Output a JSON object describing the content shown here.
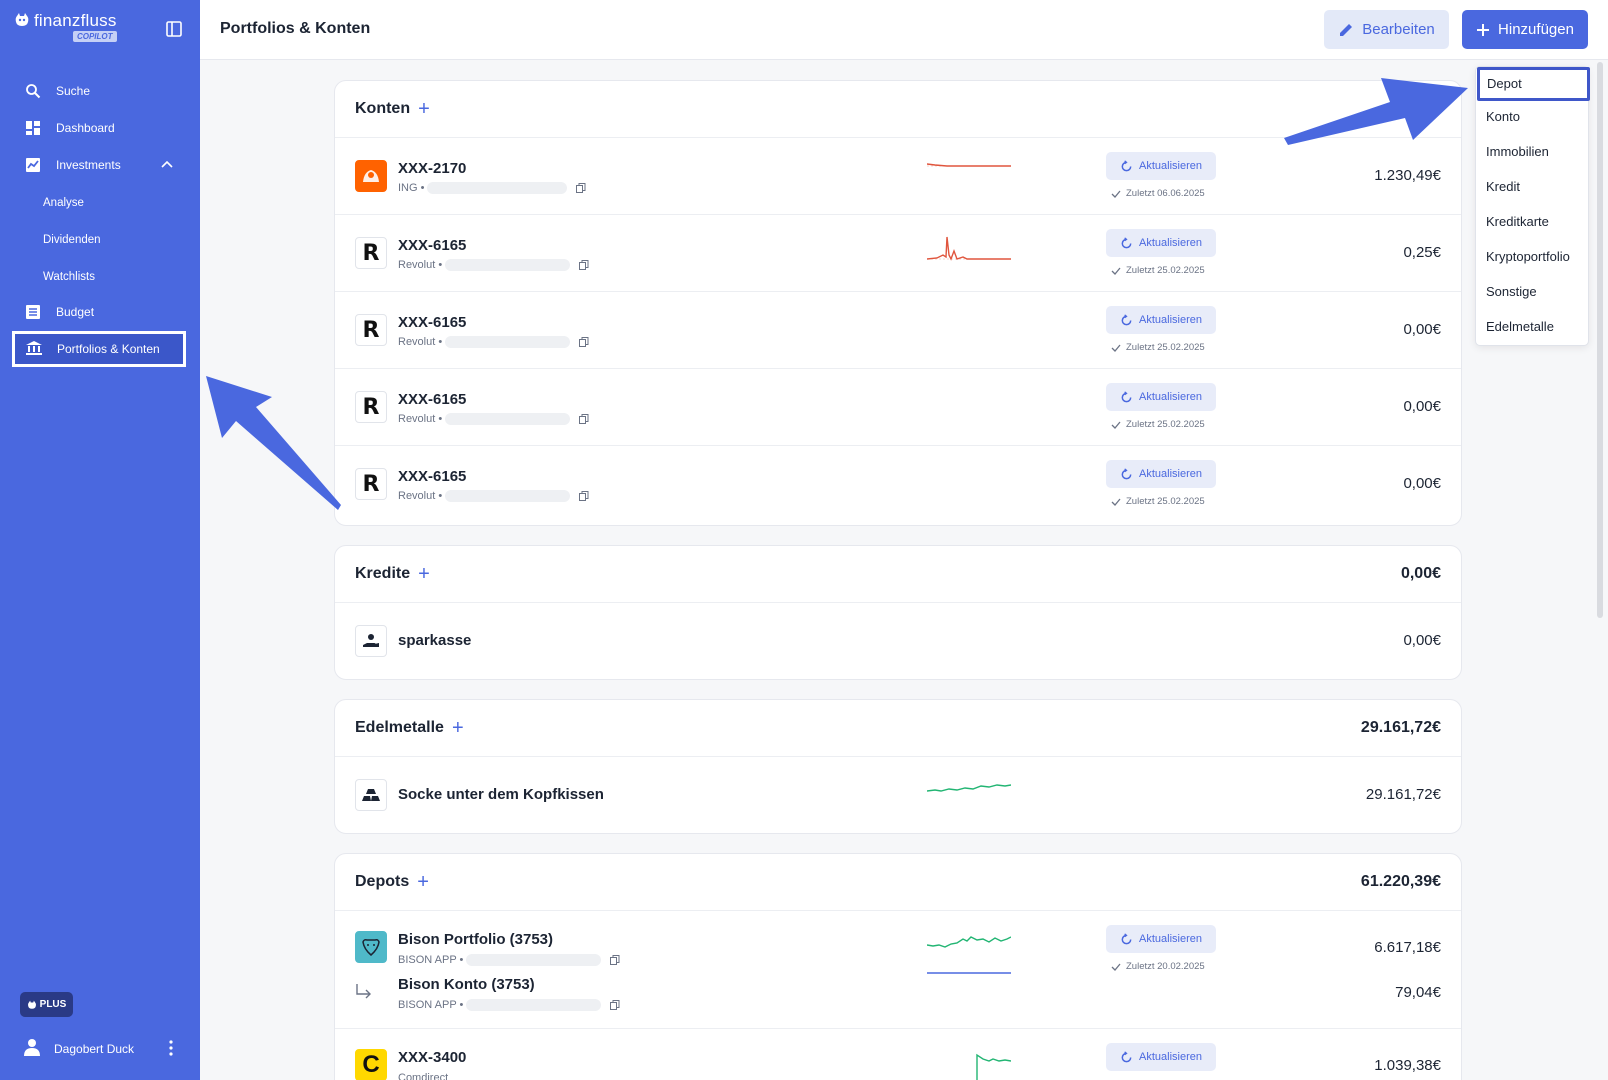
{
  "brand": {
    "name": "finanzfluss",
    "badge": "COPILOT"
  },
  "sidebar": {
    "items": [
      {
        "label": "Suche",
        "icon": "search-icon"
      },
      {
        "label": "Dashboard",
        "icon": "dashboard-icon"
      },
      {
        "label": "Investments",
        "icon": "chart-line-icon"
      },
      {
        "label": "Analyse"
      },
      {
        "label": "Dividenden"
      },
      {
        "label": "Watchlists"
      },
      {
        "label": "Budget",
        "icon": "list-icon"
      },
      {
        "label": "Portfolios & Konten",
        "icon": "bank-icon"
      }
    ],
    "plus_badge": "PLUS",
    "user_name": "Dagobert Duck"
  },
  "header": {
    "title": "Portfolios & Konten",
    "edit_label": "Bearbeiten",
    "add_label": "Hinzufügen"
  },
  "dropdown": {
    "items": [
      "Depot",
      "Konto",
      "Immobilien",
      "Kredit",
      "Kreditkarte",
      "Kryptoportfolio",
      "Sonstige",
      "Edelmetalle"
    ]
  },
  "sections": {
    "konten": {
      "title": "Konten",
      "rows": [
        {
          "name": "XXX-2170",
          "provider": "ING •",
          "refresh": "Aktualisieren",
          "updated": "Zuletzt 06.06.2025",
          "amount": "1.230,49€"
        },
        {
          "name": "XXX-6165",
          "provider": "Revolut •",
          "refresh": "Aktualisieren",
          "updated": "Zuletzt 25.02.2025",
          "amount": "0,25€"
        },
        {
          "name": "XXX-6165",
          "provider": "Revolut •",
          "refresh": "Aktualisieren",
          "updated": "Zuletzt 25.02.2025",
          "amount": "0,00€"
        },
        {
          "name": "XXX-6165",
          "provider": "Revolut •",
          "refresh": "Aktualisieren",
          "updated": "Zuletzt 25.02.2025",
          "amount": "0,00€"
        },
        {
          "name": "XXX-6165",
          "provider": "Revolut •",
          "refresh": "Aktualisieren",
          "updated": "Zuletzt 25.02.2025",
          "amount": "0,00€"
        }
      ]
    },
    "kredite": {
      "title": "Kredite",
      "total": "0,00€",
      "rows": [
        {
          "name": "sparkasse",
          "amount": "0,00€"
        }
      ]
    },
    "edelmetalle": {
      "title": "Edelmetalle",
      "total": "29.161,72€",
      "rows": [
        {
          "name": "Socke unter dem Kopfkissen",
          "amount": "29.161,72€"
        }
      ]
    },
    "depots": {
      "title": "Depots",
      "total": "61.220,39€",
      "rows": [
        {
          "name": "Bison Portfolio (3753)",
          "provider": "BISON APP •",
          "refresh": "Aktualisieren",
          "updated": "Zuletzt 20.02.2025",
          "amount": "6.617,18€"
        },
        {
          "name": "Bison Konto (3753)",
          "provider": "BISON APP •",
          "amount": "79,04€"
        },
        {
          "name": "XXX-3400",
          "provider": "Comdirect",
          "refresh": "Aktualisieren",
          "amount": "1.039,38€"
        }
      ]
    }
  },
  "colors": {
    "accent": "#4a68df",
    "negative": "#e0553d",
    "positive": "#22b573"
  }
}
